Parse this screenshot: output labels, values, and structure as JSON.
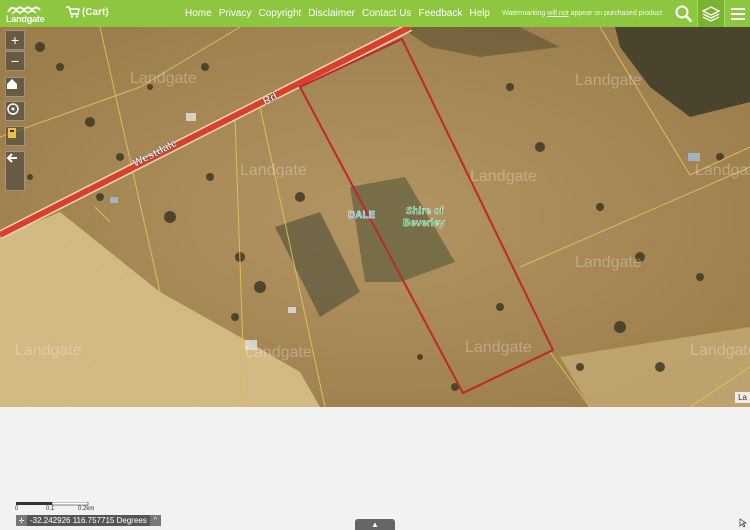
{
  "header": {
    "logo_text": "Landgate",
    "cart_label": "(Cart)",
    "nav_items": [
      "Home",
      "Privacy",
      "Copyright",
      "Disclaimer",
      "Contact Us",
      "Feedback",
      "Help"
    ],
    "watermark_note_pre": "Watermarking ",
    "watermark_note_em": "will not",
    "watermark_note_post": " appear on purchased product",
    "brand_color": "#8dc63f",
    "icons": [
      "search-icon",
      "layers-icon",
      "menu-icon"
    ]
  },
  "map": {
    "road_label_1": "Westdale",
    "road_label_2": "Rd",
    "locality_label": "DALE",
    "shire_label_line1": "Shire of",
    "shire_label_line2": "Beverley",
    "watermark": "Landgate",
    "corner_label": "La",
    "parcel_color": "#c0272d",
    "road_color": "#d9402b",
    "cadastre_color": "#e2c25a"
  },
  "tools": [
    "zoom-in-icon",
    "zoom-out-icon",
    "home-icon",
    "locate-icon",
    "legend-icon",
    "back-icon"
  ],
  "footer": {
    "scale_labels": [
      "0",
      "0.1",
      "0.2km"
    ],
    "coordinates": "-32.242926 116.757715 Degrees",
    "expand_tab": "▲"
  }
}
